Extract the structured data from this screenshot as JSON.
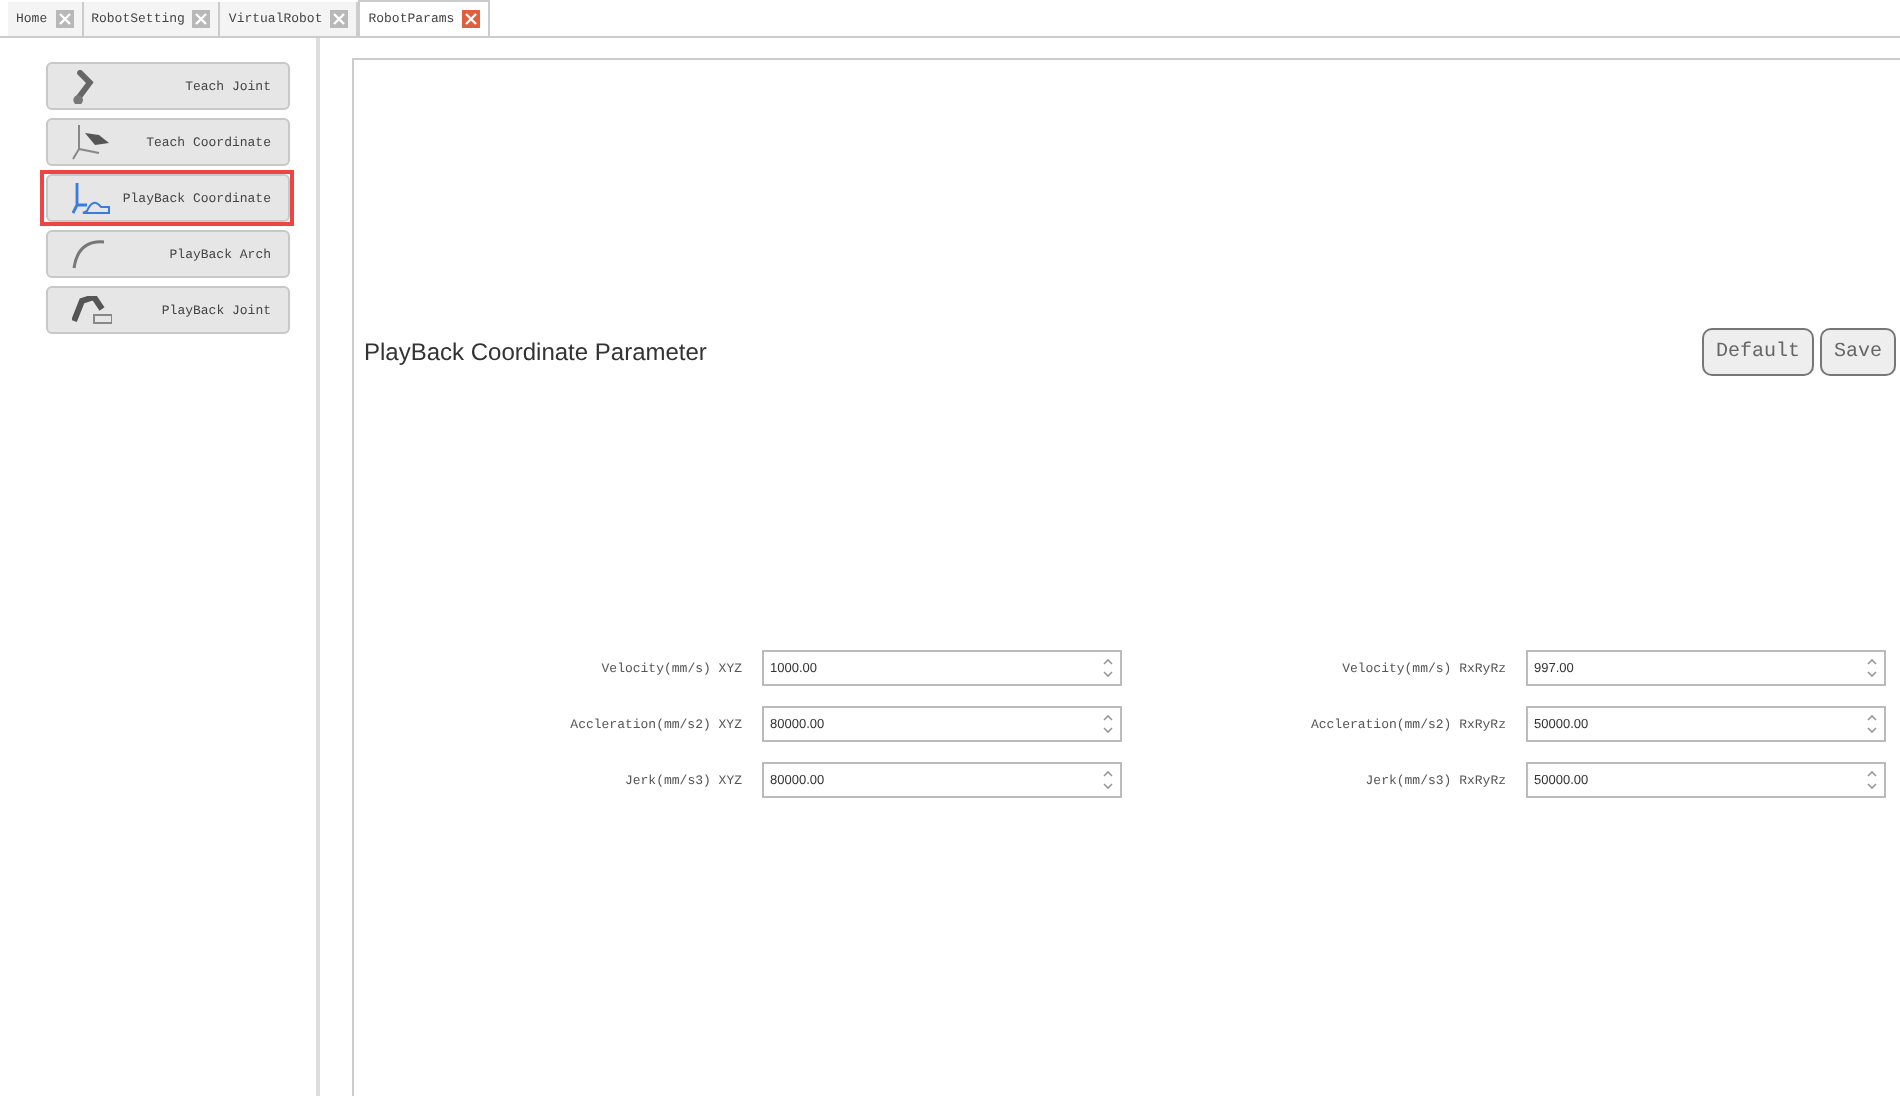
{
  "tabs": [
    {
      "label": "Home",
      "selected": false
    },
    {
      "label": "RobotSetting",
      "selected": false
    },
    {
      "label": "VirtualRobot",
      "selected": false
    },
    {
      "label": "RobotParams",
      "selected": true
    }
  ],
  "sidebar": {
    "items": [
      {
        "label": "Teach Joint",
        "selected": false
      },
      {
        "label": "Teach Coordinate",
        "selected": false
      },
      {
        "label": "PlayBack Coordinate",
        "selected": true
      },
      {
        "label": "PlayBack Arch",
        "selected": false
      },
      {
        "label": "PlayBack Joint",
        "selected": false
      }
    ]
  },
  "panel": {
    "title": "PlayBack Coordinate Parameter",
    "buttons": [
      "Default",
      "Save"
    ],
    "left_fields": [
      {
        "label": "Velocity(mm/s) XYZ",
        "value": "1000.00"
      },
      {
        "label": "Accleration(mm/s2) XYZ",
        "value": "80000.00"
      },
      {
        "label": "Jerk(mm/s3) XYZ",
        "value": "80000.00"
      }
    ],
    "right_fields": [
      {
        "label": "Velocity(mm/s) RxRyRz",
        "value": "997.00"
      },
      {
        "label": "Accleration(mm/s2) RxRyRz",
        "value": "50000.00"
      },
      {
        "label": "Jerk(mm/s3) RxRyRz",
        "value": "50000.00"
      }
    ]
  }
}
